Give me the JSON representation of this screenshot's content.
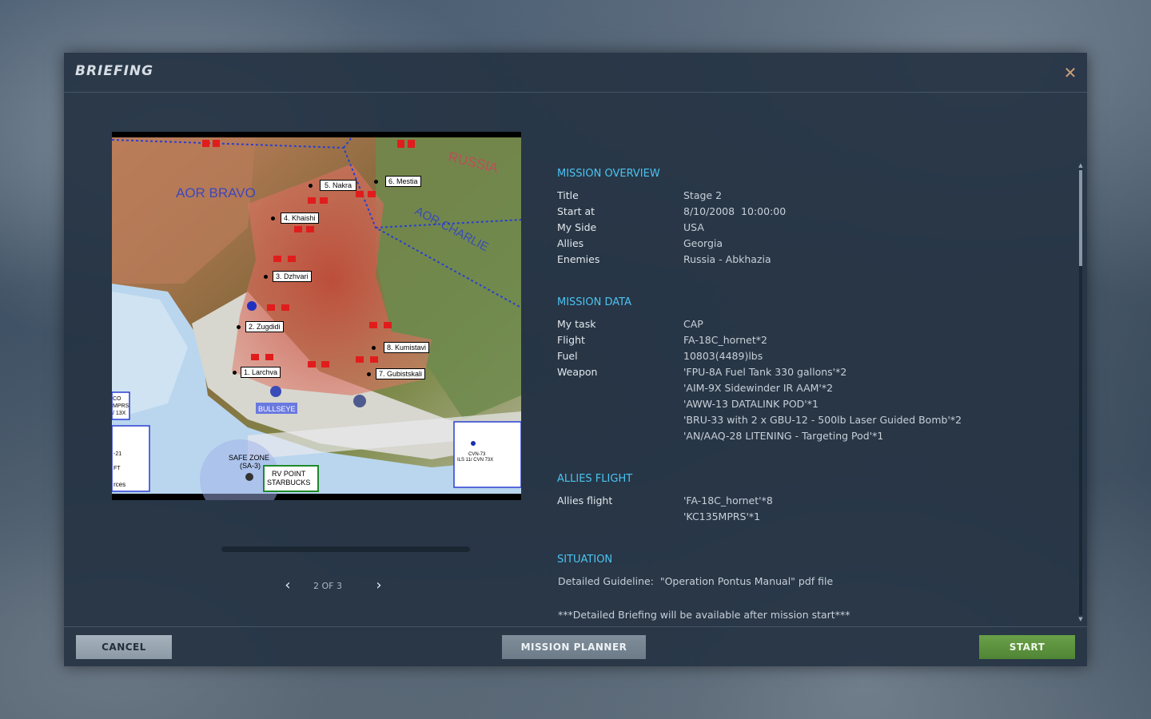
{
  "dialog": {
    "title": "BRIEFING",
    "close_icon": "close-icon"
  },
  "map": {
    "labels": {
      "aor_bravo": "AOR BRAVO",
      "aor_charlie": "AOR CHARLIE",
      "russia": "RUSSIA",
      "bullseye": "BULLSEYE",
      "safe_zone": "SAFE ZONE",
      "safe_zone_sub": "(SA-3)",
      "rv_point": "RV POINT",
      "rv_point_sub": "STARBUCKS",
      "cvn": "CVN-73",
      "cvn_sub": "ILS 11/ CVN 73X",
      "left_box_1": "CO",
      "left_box_2": "MPRS",
      "left_box_3": "/ 13X",
      "left_box_4": "-21",
      "left_box_5": "FT",
      "left_box_6": "rces"
    },
    "waypoints": [
      {
        "label": "1. Larchva"
      },
      {
        "label": "2. Zugdidi"
      },
      {
        "label": "3. Dzhvari"
      },
      {
        "label": "4. Khaishi"
      },
      {
        "label": "5. Nakra"
      },
      {
        "label": "6. Mestia"
      },
      {
        "label": "7. Gubistskali"
      },
      {
        "label": "8. Kumistavi"
      }
    ]
  },
  "pager": {
    "prev_icon": "chevron-left-icon",
    "next_icon": "chevron-right-icon",
    "count": "2 OF 3",
    "current": 2,
    "total": 3
  },
  "overview": {
    "heading": "MISSION OVERVIEW",
    "rows": [
      {
        "key": "Title",
        "value": "Stage 2"
      },
      {
        "key": "Start at",
        "value": "8/10/2008  10:00:00"
      },
      {
        "key": "My Side",
        "value": "USA"
      },
      {
        "key": "Allies",
        "value": "Georgia"
      },
      {
        "key": "Enemies",
        "value": "Russia - Abkhazia"
      }
    ]
  },
  "mission_data": {
    "heading": "MISSION DATA",
    "rows": [
      {
        "key": "My task",
        "value": "CAP"
      },
      {
        "key": "Flight",
        "value": "FA-18C_hornet*2"
      },
      {
        "key": "Fuel",
        "value": "10803(4489)lbs"
      },
      {
        "key": "Weapon",
        "value": "'FPU-8A Fuel Tank 330 gallons'*2"
      },
      {
        "key": "",
        "value": "'AIM-9X Sidewinder IR AAM'*2"
      },
      {
        "key": "",
        "value": "'AWW-13 DATALINK POD'*1"
      },
      {
        "key": "",
        "value": "'BRU-33 with 2 x GBU-12 - 500lb Laser Guided Bomb'*2"
      },
      {
        "key": "",
        "value": "'AN/AAQ-28 LITENING - Targeting Pod'*1"
      }
    ]
  },
  "allies_flight": {
    "heading": "ALLIES FLIGHT",
    "rows": [
      {
        "key": "Allies flight",
        "value": "'FA-18C_hornet'*8"
      },
      {
        "key": "",
        "value": "'KC135MPRS'*1"
      }
    ]
  },
  "situation": {
    "heading": "SITUATION",
    "line1": "Detailed Guideline:  \"Operation Pontus Manual\" pdf file",
    "line2": "***Detailed Briefing will be available after mission start***"
  },
  "footer": {
    "cancel_label": "CANCEL",
    "planner_label": "MISSION PLANNER",
    "start_label": "START"
  },
  "colors": {
    "accent": "#4cc3f0",
    "start_button": "#5a9240",
    "close": "#c9a07a"
  }
}
